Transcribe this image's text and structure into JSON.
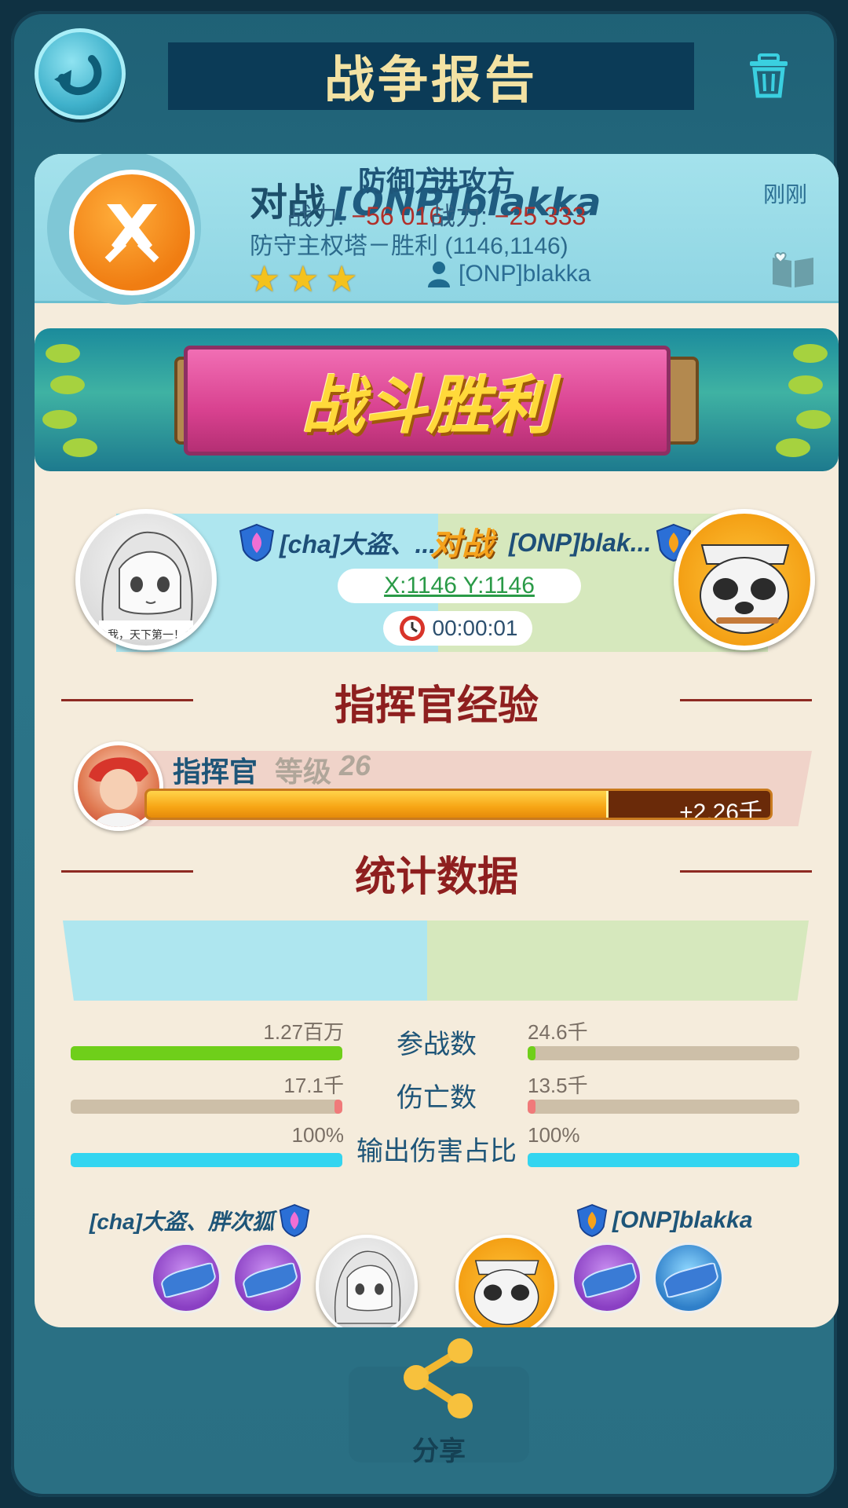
{
  "header": {
    "title": "战争报告",
    "back_icon": "back-arrow-icon",
    "trash_icon": "trash-icon"
  },
  "report": {
    "prefix": "对战",
    "opponent": "[ONP]blakka",
    "time": "刚刚",
    "subtitle": "防守主权塔－胜利 (1146,1146)",
    "stars": 3,
    "player": "[ONP]blakka"
  },
  "banner": {
    "text": "战斗胜利"
  },
  "versus": {
    "left_name": "[cha]大盗、...",
    "mid": "对战",
    "right_name": "[ONP]blak...",
    "coords": "X:1146 Y:1146",
    "duration": "00:00:01",
    "left_avatar_caption": "我，天下第一！"
  },
  "commander": {
    "heading": "指挥官经验",
    "label": "指挥官",
    "level_word": "等级",
    "level": "26",
    "xp_gain": "+2.26千",
    "xp_progress": 0.74
  },
  "stats": {
    "heading": "统计数据",
    "defender_label": "防御方",
    "attacker_label": "进攻方",
    "defender_power_label": "战力: ",
    "defender_power": "−56 016",
    "attacker_power_label": "战力: ",
    "attacker_power": "−25 333",
    "rows": [
      {
        "label": "参战数",
        "left": "1.27百万",
        "right": "24.6千",
        "left_fill": 1.0,
        "right_fill": 0.03,
        "left_color": "#6fcf1a",
        "right_color": "#6fcf1a"
      },
      {
        "label": "伤亡数",
        "left": "17.1千",
        "right": "13.5千",
        "left_fill": 0.03,
        "right_fill": 0.03,
        "left_color": "#f07a7a",
        "right_color": "#f07a7a"
      },
      {
        "label": "输出伤害占比",
        "left": "100%",
        "right": "100%",
        "left_fill": 1.0,
        "right_fill": 1.0,
        "left_color": "#33d5f0",
        "right_color": "#33d5f0"
      }
    ]
  },
  "troops": {
    "left_name": "[cha]大盗、胖次狐",
    "right_name": "[ONP]blakka"
  },
  "share": {
    "label": "分享"
  },
  "colors": {
    "accent_red": "#8e1f1f",
    "text_blue": "#1e5578",
    "panel": "#f5ecdc"
  }
}
